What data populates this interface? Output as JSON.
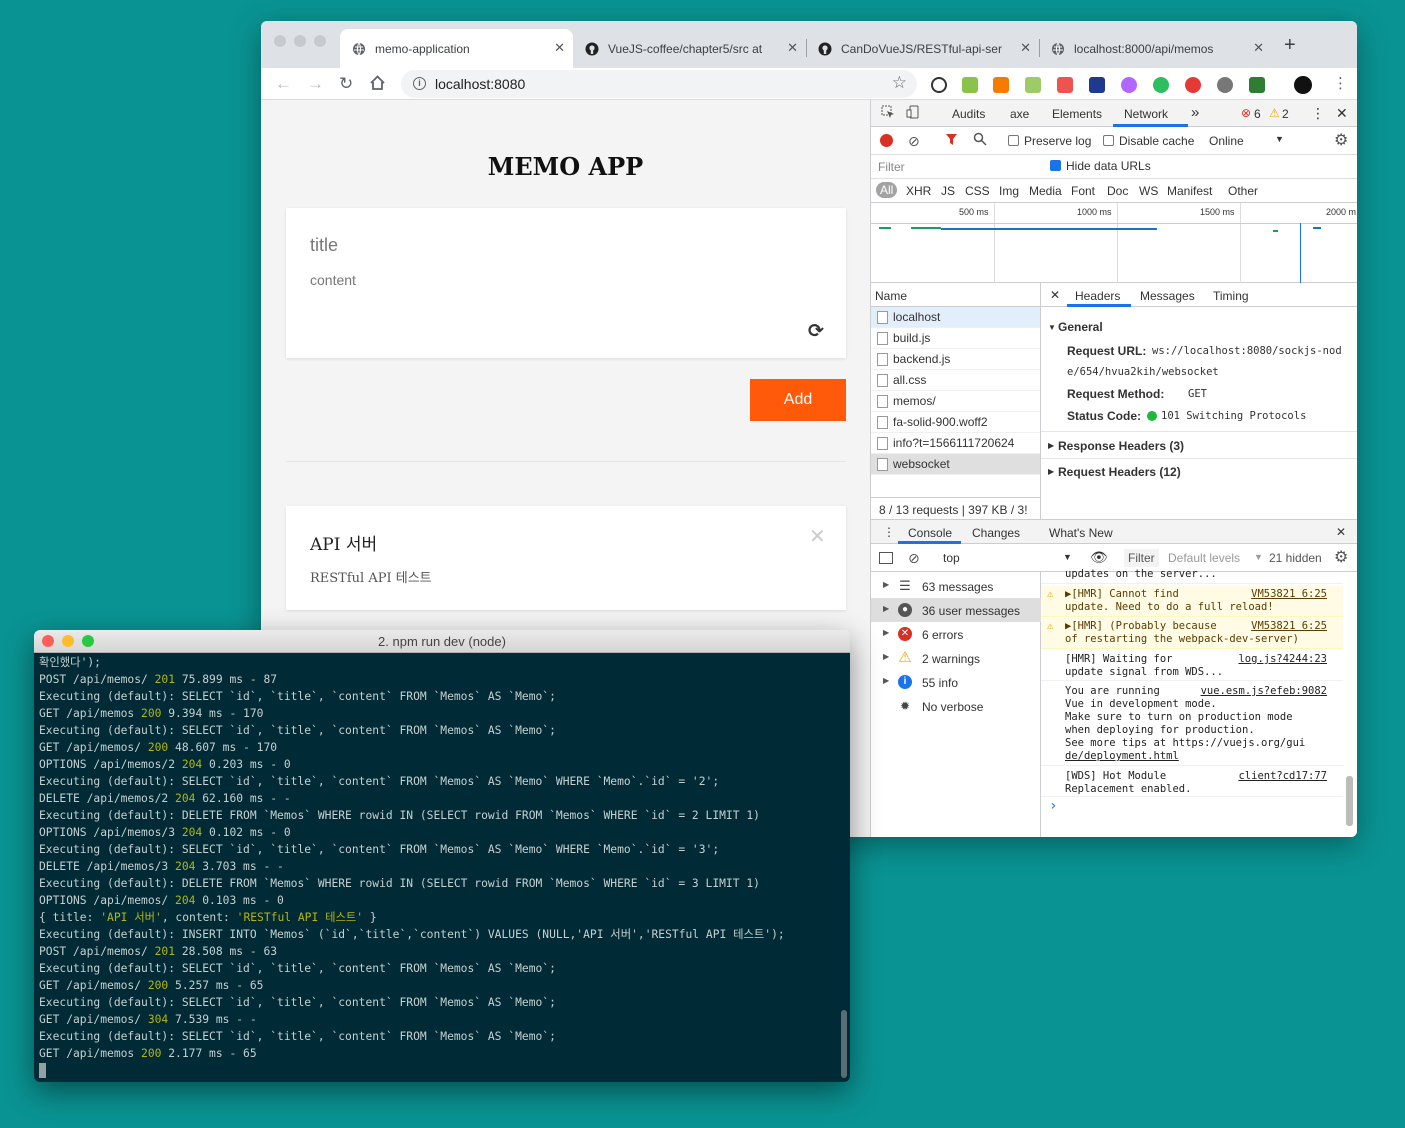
{
  "browser": {
    "tabs": [
      {
        "label": "memo-application",
        "icon": "globe-icon"
      },
      {
        "label": "VueJS-coffee/chapter5/src at",
        "icon": "github-icon"
      },
      {
        "label": "CanDoVueJS/RESTful-api-ser",
        "icon": "github-icon"
      },
      {
        "label": "localhost:8000/api/memos",
        "icon": "globe-icon"
      }
    ],
    "url": "localhost:8080"
  },
  "app": {
    "title": "MEMO APP",
    "title_placeholder": "title",
    "content_placeholder": "content",
    "add_label": "Add",
    "memos": [
      {
        "title": "API 서버",
        "content": "RESTful API 테스트"
      }
    ]
  },
  "devtools": {
    "panels": [
      "Audits",
      "axe",
      "Elements",
      "Network"
    ],
    "more": "»",
    "errors": "6",
    "warnings": "2",
    "preserve_log": "Preserve log",
    "disable_cache": "Disable cache",
    "throttle": "Online",
    "filter_placeholder": "Filter",
    "hide_data_urls": "Hide data URLs",
    "types": [
      "All",
      "XHR",
      "JS",
      "CSS",
      "Img",
      "Media",
      "Font",
      "Doc",
      "WS",
      "Manifest",
      "Other"
    ],
    "timeline_ticks": [
      "500 ms",
      "1000 ms",
      "1500 ms",
      "2000 m"
    ],
    "name_header": "Name",
    "requests": [
      "localhost",
      "build.js",
      "backend.js",
      "all.css",
      "memos/",
      "fa-solid-900.woff2",
      "info?t=1566111720624",
      "websocket"
    ],
    "footer": "8 / 13 requests  |  397 KB / 3!",
    "detail_tabs": [
      "Headers",
      "Messages",
      "Timing"
    ],
    "general": {
      "label": "General",
      "url_label": "Request URL:",
      "url_value_1": "ws://localhost:8080/sockjs-nod",
      "url_value_2": "e/654/hvua2kih/websocket",
      "method_label": "Request Method:",
      "method_value": "GET",
      "status_label": "Status Code:",
      "status_value": "101 Switching Protocols"
    },
    "response_headers": "Response Headers (3)",
    "request_headers": "Request Headers (12)",
    "drawer_tabs": [
      "Console",
      "Changes",
      "What's New"
    ],
    "context": "top",
    "console_filter": "Filter",
    "levels": "Default levels",
    "hidden": "21 hidden",
    "sidebar": [
      {
        "label": "63 messages",
        "icon": "list-icon"
      },
      {
        "label": "36 user messages",
        "icon": "user-icon"
      },
      {
        "label": "6 errors",
        "icon": "error-icon"
      },
      {
        "label": "2 warnings",
        "icon": "warning-icon"
      },
      {
        "label": "55 info",
        "icon": "info-icon"
      },
      {
        "label": "No verbose",
        "icon": "bug-icon"
      }
    ],
    "console_messages": [
      {
        "lines": [
          "updates on the server..."
        ],
        "src": "",
        "type": "log"
      },
      {
        "lines": [
          "▶[HMR] Cannot find",
          "update. Need to do a full reload!"
        ],
        "src": "VM53821 6:25",
        "type": "warn"
      },
      {
        "lines": [
          "▶[HMR] (Probably because",
          "of restarting the webpack-dev-server)"
        ],
        "src": "VM53821 6:25",
        "type": "warn"
      },
      {
        "lines": [
          "[HMR] Waiting for",
          "update signal from WDS..."
        ],
        "src": "log.js?4244:23",
        "type": "log"
      },
      {
        "lines": [
          "You are running",
          "Vue in development mode.",
          "Make sure to turn on production mode",
          "when deploying for production.",
          "See more tips at https://vuejs.org/gui",
          "de/deployment.html"
        ],
        "src": "vue.esm.js?efeb:9082",
        "type": "log"
      },
      {
        "lines": [
          "[WDS] Hot Module",
          "Replacement enabled."
        ],
        "src": "client?cd17:77",
        "type": "log"
      }
    ],
    "prompt": "›"
  },
  "terminal": {
    "title": "2. npm run dev (node)",
    "lines": [
      "확인했다');",
      "POST /api/memos/ 201 75.899 ms - 87",
      "Executing (default): SELECT `id`, `title`, `content` FROM `Memos` AS `Memo`;",
      "GET /api/memos 200 9.394 ms - 170",
      "Executing (default): SELECT `id`, `title`, `content` FROM `Memos` AS `Memo`;",
      "GET /api/memos/ 200 48.607 ms - 170",
      "OPTIONS /api/memos/2 204 0.203 ms - 0",
      "Executing (default): SELECT `id`, `title`, `content` FROM `Memos` AS `Memo` WHERE `Memo`.`id` = '2';",
      "DELETE /api/memos/2 204 62.160 ms - -",
      "Executing (default): DELETE FROM `Memos` WHERE rowid IN (SELECT rowid FROM `Memos` WHERE `id` = 2 LIMIT 1)",
      "OPTIONS /api/memos/3 204 0.102 ms - 0",
      "Executing (default): SELECT `id`, `title`, `content` FROM `Memos` AS `Memo` WHERE `Memo`.`id` = '3';",
      "DELETE /api/memos/3 204 3.703 ms - -",
      "Executing (default): DELETE FROM `Memos` WHERE rowid IN (SELECT rowid FROM `Memos` WHERE `id` = 3 LIMIT 1)",
      "OPTIONS /api/memos/ 204 0.103 ms - 0",
      "{ title: 'API 서버', content: 'RESTful API 테스트' }",
      "Executing (default): INSERT INTO `Memos` (`id`,`title`,`content`) VALUES (NULL,'API 서버','RESTful API 테스트');",
      "POST /api/memos/ 201 28.508 ms - 63",
      "Executing (default): SELECT `id`, `title`, `content` FROM `Memos` AS `Memo`;",
      "GET /api/memos/ 200 5.257 ms - 65",
      "Executing (default): SELECT `id`, `title`, `content` FROM `Memos` AS `Memo`;",
      "GET /api/memos/ 304 7.539 ms - -",
      "Executing (default): SELECT `id`, `title`, `content` FROM `Memos` AS `Memo`;",
      "GET /api/memos 200 2.177 ms - 65"
    ]
  },
  "colors": {
    "desktop": "#0a9393",
    "accent": "#ff5a0a",
    "terminal_bg": "#002b36"
  }
}
